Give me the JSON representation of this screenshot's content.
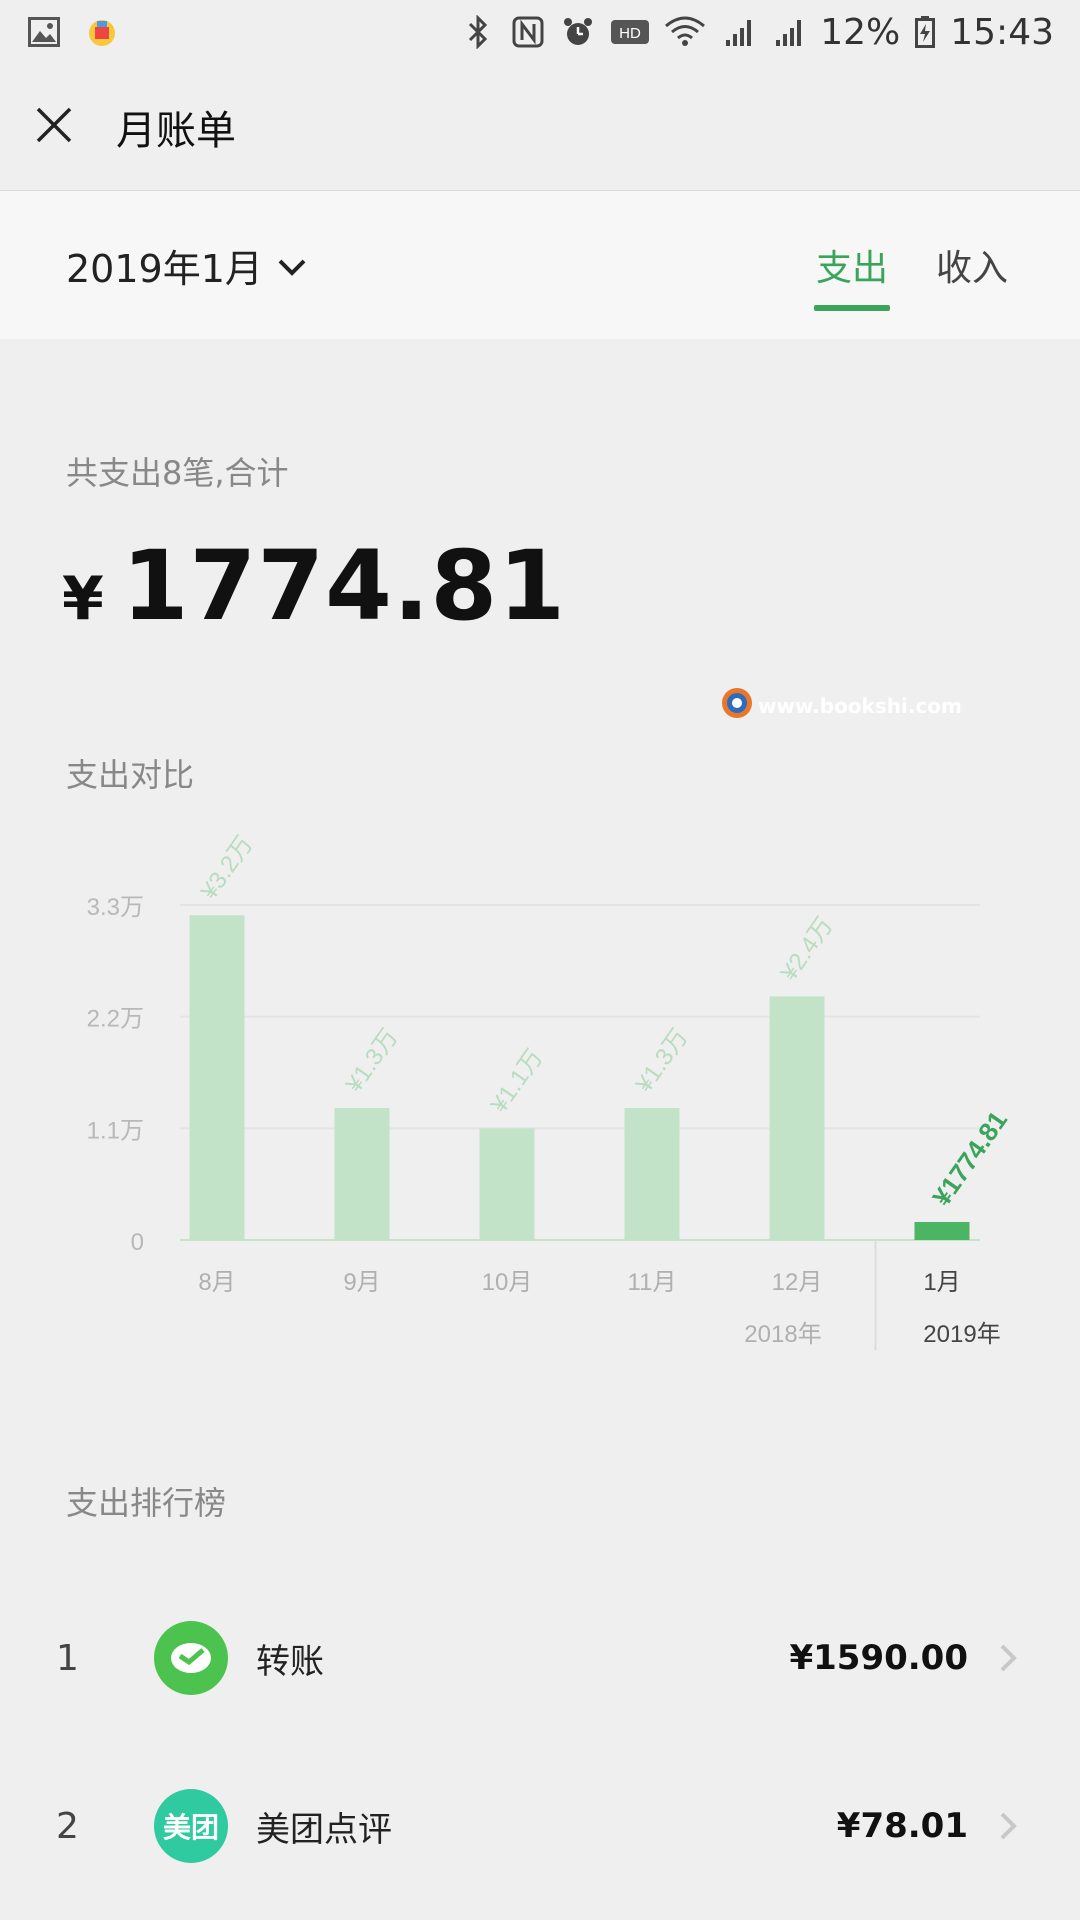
{
  "status_bar": {
    "battery": "12%",
    "time": "15:43",
    "icons": [
      "image-icon",
      "app-icon",
      "bluetooth-icon",
      "nfc-icon",
      "alarm-icon",
      "hd-icon",
      "wifi-icon",
      "signal-4g-icon",
      "signal-e-icon",
      "battery-icon"
    ],
    "hd_label": "HD"
  },
  "nav": {
    "title": "月账单"
  },
  "month_bar": {
    "selected_month": "2019年1月",
    "tabs": [
      {
        "label": "支出",
        "active": true
      },
      {
        "label": "收入",
        "active": false
      }
    ]
  },
  "summary": {
    "label": "共支出8笔,合计",
    "currency": "¥",
    "amount": "1774.81"
  },
  "watermark": "www.bookshi.com",
  "chart_section_title": "支出对比",
  "chart_data": {
    "type": "bar",
    "categories": [
      "8月",
      "9月",
      "10月",
      "11月",
      "12月",
      "1月"
    ],
    "values": [
      32000,
      13000,
      11000,
      13000,
      24000,
      1774.81
    ],
    "data_labels": [
      "¥3.2万",
      "¥1.3万",
      "¥1.1万",
      "¥1.3万",
      "¥2.4万",
      "¥1774.81"
    ],
    "y_ticks": [
      0,
      11000,
      22000,
      33000
    ],
    "y_tick_labels": [
      "0",
      "1.1万",
      "2.2万",
      "3.3万"
    ],
    "ylim": [
      0,
      33000
    ],
    "year_labels": [
      "2018年",
      "2019年"
    ],
    "highlight_index": 5,
    "colors": {
      "bar": "#c3e3c8",
      "bar_highlight": "#4cb563",
      "label": "#b8dcc0",
      "label_highlight": "#3aa55a"
    },
    "grid": true
  },
  "ranking": {
    "title": "支出排行榜",
    "items": [
      {
        "rank": "1",
        "name": "转账",
        "amount": "¥1590.00",
        "logo_icon": "wechat-transfer-icon",
        "logo_color": "#4cc34f"
      },
      {
        "rank": "2",
        "name": "美团点评",
        "amount": "¥78.01",
        "logo_icon": "meituan-icon",
        "logo_color": "#2fcaa0",
        "logo_text": "美团"
      }
    ]
  }
}
